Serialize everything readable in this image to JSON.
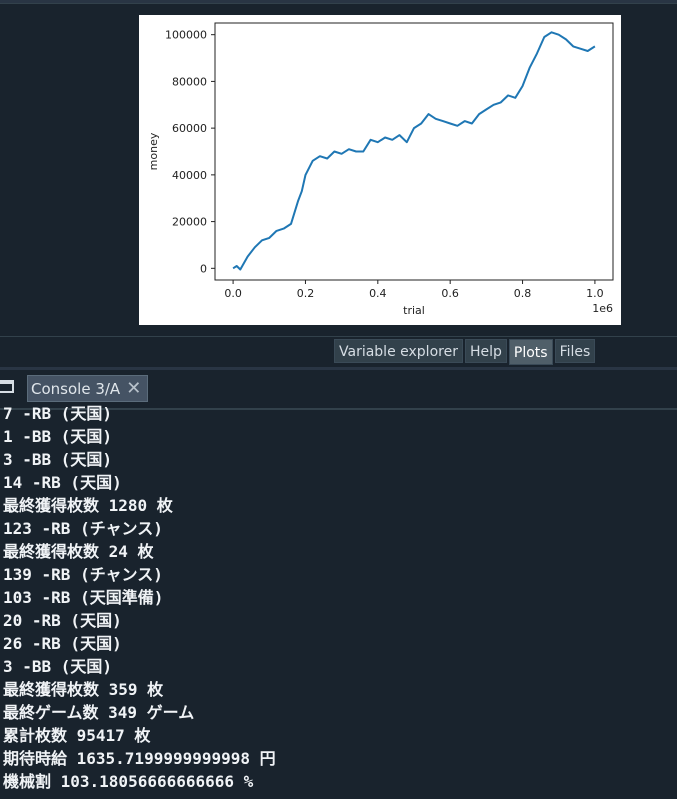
{
  "chart_data": {
    "type": "line",
    "xlabel": "trial",
    "ylabel": "money",
    "x_offset_label": "1e6",
    "xlim": [
      -0.05,
      1.05
    ],
    "ylim": [
      -5000,
      105000
    ],
    "xticks": [
      0.0,
      0.2,
      0.4,
      0.6,
      0.8,
      1.0
    ],
    "xtick_labels": [
      "0.0",
      "0.2",
      "0.4",
      "0.6",
      "0.8",
      "1.0"
    ],
    "yticks": [
      0,
      20000,
      40000,
      60000,
      80000,
      100000
    ],
    "ytick_labels": [
      "0",
      "20000",
      "40000",
      "60000",
      "80000",
      "100000"
    ],
    "grid": false,
    "series": [
      {
        "color": "#1f77b4",
        "x": [
          0.0,
          0.01,
          0.02,
          0.04,
          0.06,
          0.08,
          0.1,
          0.12,
          0.14,
          0.16,
          0.18,
          0.19,
          0.2,
          0.22,
          0.24,
          0.26,
          0.28,
          0.3,
          0.32,
          0.34,
          0.36,
          0.38,
          0.4,
          0.42,
          0.44,
          0.46,
          0.48,
          0.5,
          0.52,
          0.54,
          0.56,
          0.58,
          0.6,
          0.62,
          0.64,
          0.66,
          0.68,
          0.7,
          0.72,
          0.74,
          0.76,
          0.78,
          0.8,
          0.82,
          0.84,
          0.86,
          0.88,
          0.9,
          0.92,
          0.94,
          0.96,
          0.98,
          1.0
        ],
        "y": [
          0,
          1000,
          -500,
          5000,
          9000,
          12000,
          13000,
          16000,
          17000,
          19000,
          29000,
          33000,
          40000,
          46000,
          48000,
          47000,
          50000,
          49000,
          51000,
          50000,
          50000,
          55000,
          54000,
          56000,
          55000,
          57000,
          54000,
          60000,
          62000,
          66000,
          64000,
          63000,
          62000,
          61000,
          63000,
          62000,
          66000,
          68000,
          70000,
          71000,
          74000,
          73000,
          78000,
          86000,
          92000,
          99000,
          101000,
          100000,
          98000,
          95000,
          94000,
          93000,
          95000
        ]
      }
    ]
  },
  "tabs": [
    "Variable explorer",
    "Help",
    "Plots",
    "Files"
  ],
  "active_tab": "Plots",
  "console_tab_label": "Console 3/A",
  "console_lines": [
    "7 -RB (天国)",
    "1 -BB (天国)",
    "3 -BB (天国)",
    "14 -RB (天国)",
    "最終獲得枚数 1280 枚",
    "123 -RB (チャンス)",
    "最終獲得枚数 24 枚",
    "139 -RB (チャンス)",
    "103 -RB (天国準備)",
    "20 -RB (天国)",
    "26 -RB (天国)",
    "3 -BB (天国)",
    "最終獲得枚数 359 枚",
    "最終ゲーム数 349 ゲーム",
    "累計枚数 95417 枚",
    "期待時給 1635.7199999999998 円",
    "機械割 103.18056666666666 %"
  ]
}
